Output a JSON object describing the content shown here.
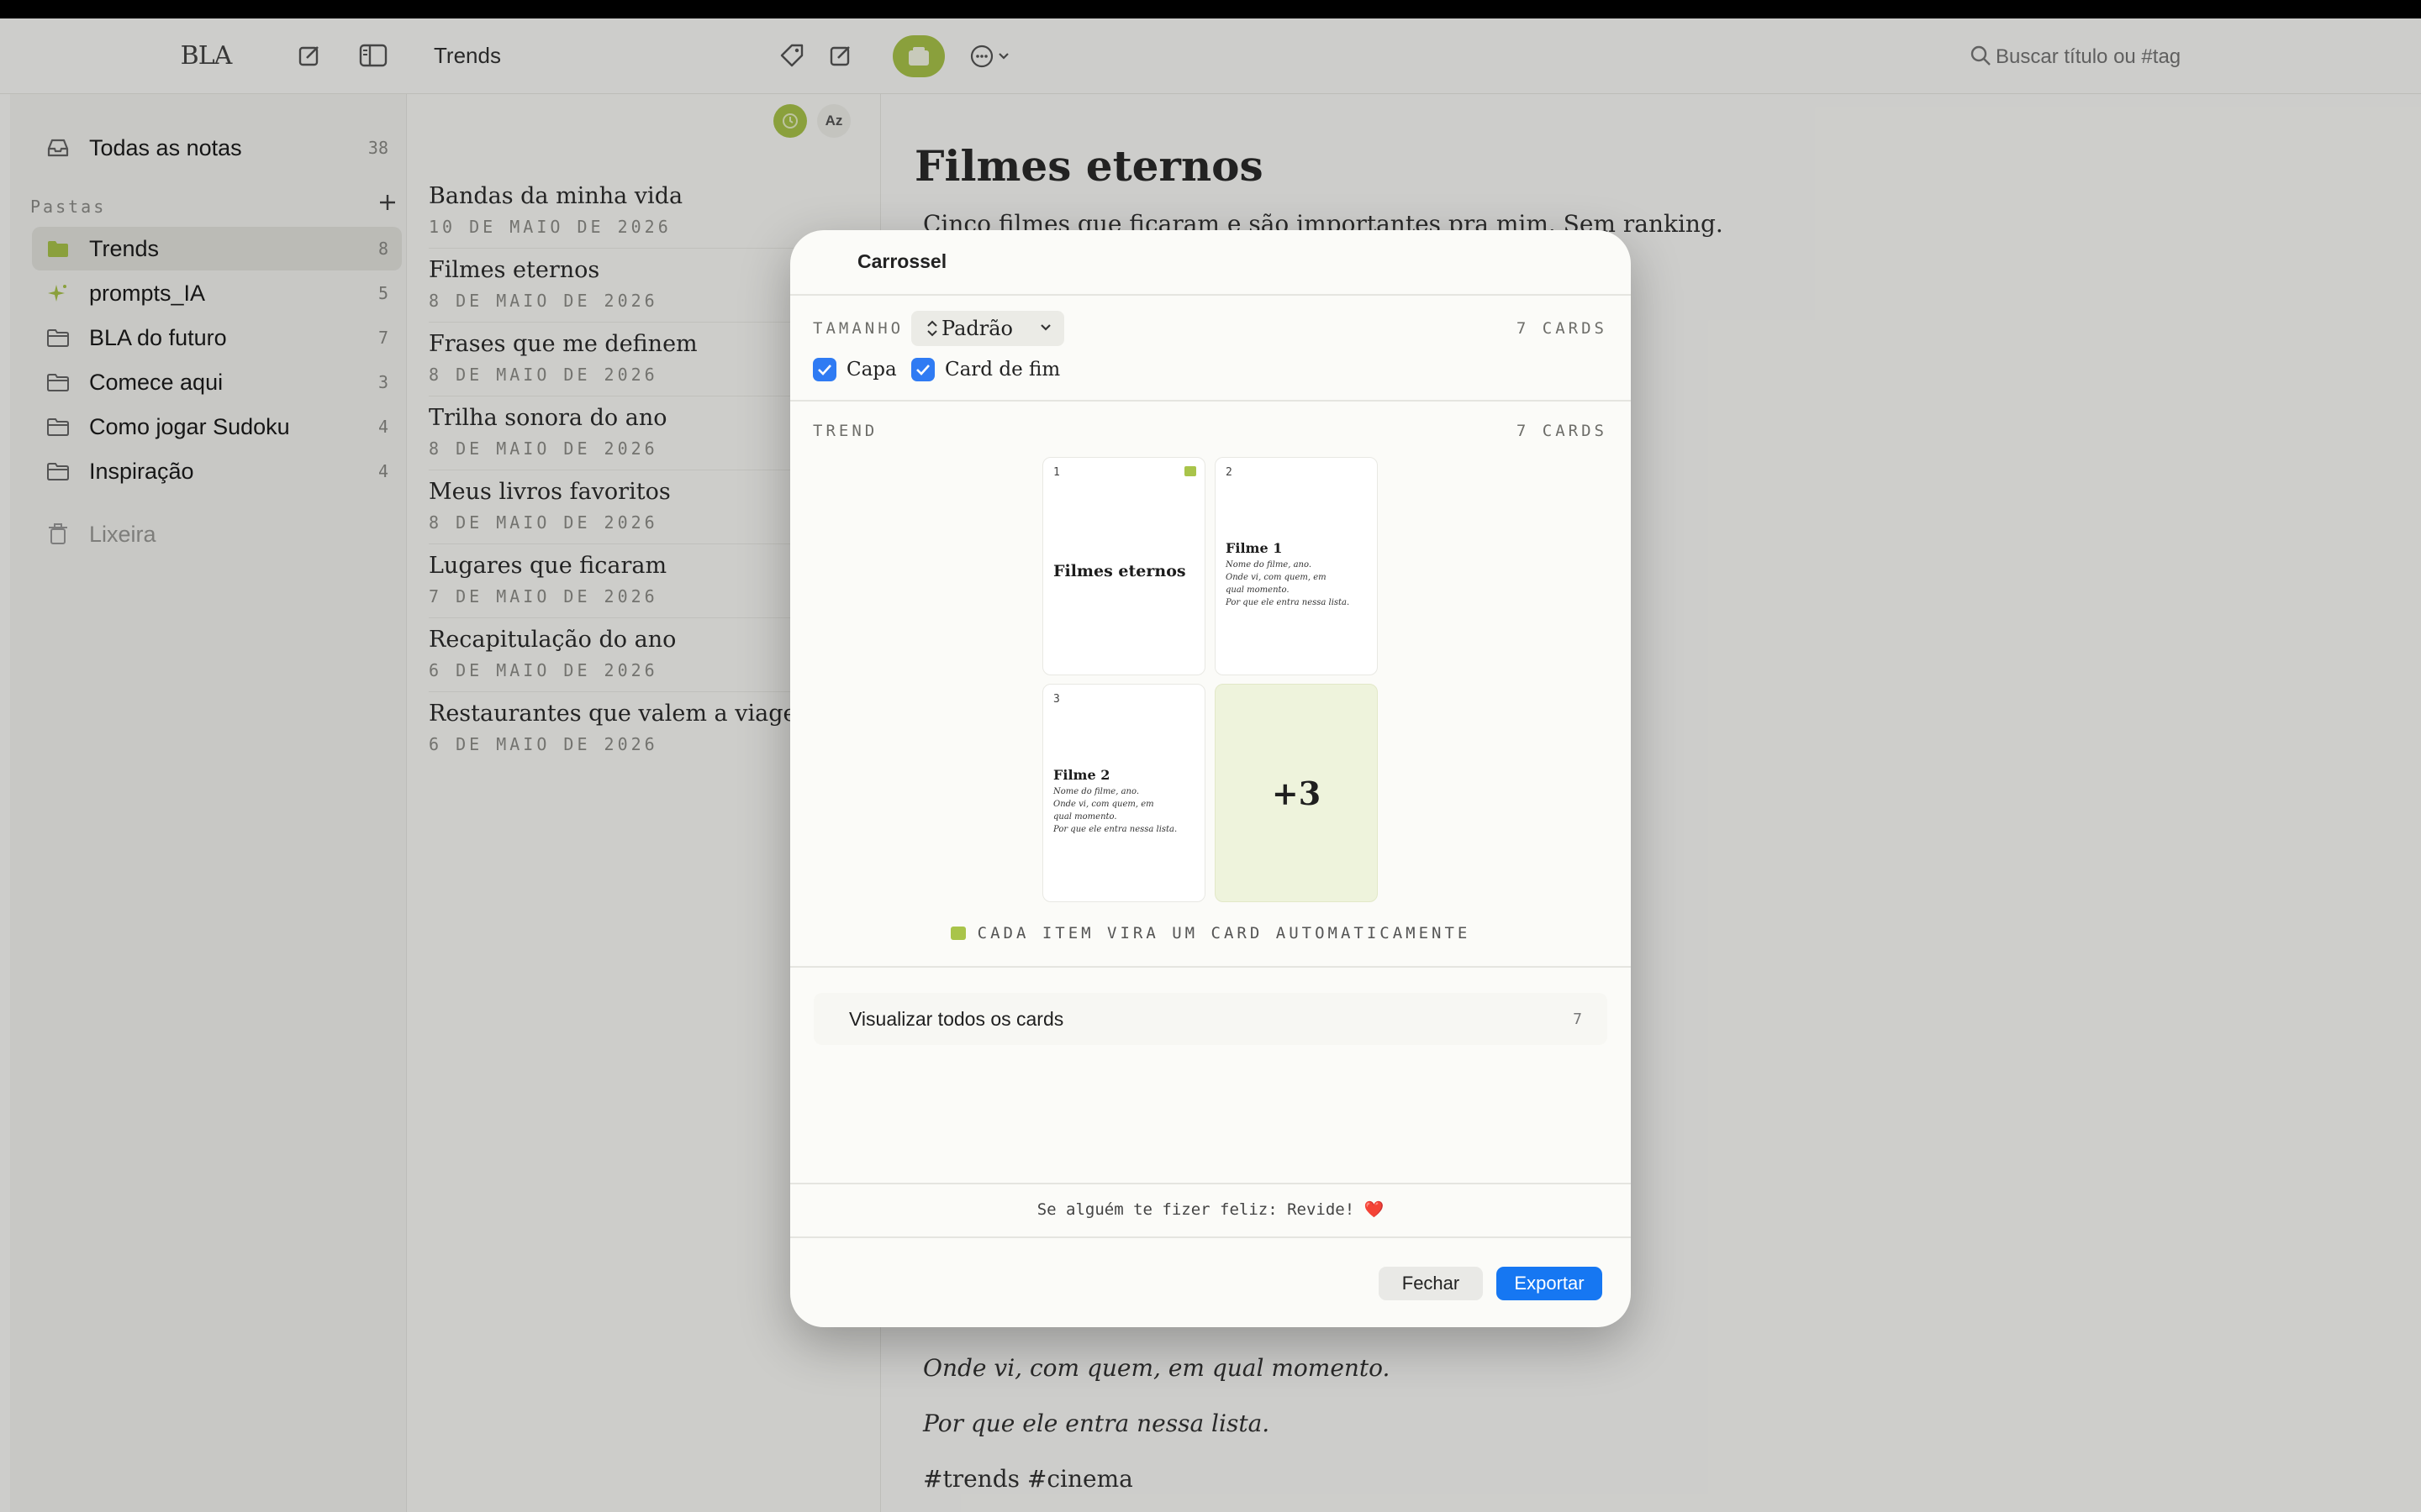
{
  "toolbar": {
    "logo": "BLA",
    "folder_title": "Trends",
    "search_placeholder": "Buscar título ou #tag"
  },
  "sidebar": {
    "all_notes": {
      "label": "Todas as notas",
      "count": "38"
    },
    "folders_heading": "Pastas",
    "folders": [
      {
        "label": "Trends",
        "count": "8",
        "icon": "folder-filled-icon"
      },
      {
        "label": "prompts_IA",
        "count": "5",
        "icon": "sparkle-icon"
      },
      {
        "label": "BLA do futuro",
        "count": "7",
        "icon": "folder-icon"
      },
      {
        "label": "Comece aqui",
        "count": "3",
        "icon": "folder-icon"
      },
      {
        "label": "Como jogar Sudoku",
        "count": "4",
        "icon": "folder-icon"
      },
      {
        "label": "Inspiração",
        "count": "4",
        "icon": "folder-icon"
      }
    ],
    "trash": "Lixeira"
  },
  "notelist": {
    "sort_label": "Az",
    "notes": [
      {
        "title": "Bandas da minha vida",
        "date": "10 DE MAIO DE 2026"
      },
      {
        "title": "Filmes eternos",
        "date": "8 DE MAIO DE 2026"
      },
      {
        "title": "Frases que me definem",
        "date": "8 DE MAIO DE 2026"
      },
      {
        "title": "Trilha sonora do ano",
        "date": "8 DE MAIO DE 2026"
      },
      {
        "title": "Meus livros favoritos",
        "date": "8 DE MAIO DE 2026"
      },
      {
        "title": "Lugares que ficaram",
        "date": "7 DE MAIO DE 2026"
      },
      {
        "title": "Recapitulação do ano",
        "date": "6 DE MAIO DE 2026"
      },
      {
        "title": "Restaurantes que valem a viagem",
        "date": "6 DE MAIO DE 2026"
      }
    ]
  },
  "editor": {
    "title": "Filmes eternos",
    "intro": "Cinco filmes que ficaram e são importantes pra mim. Sem ranking.",
    "line1": "Onde vi, com quem, em qual momento.",
    "line2": "Por que ele entra nessa lista.",
    "tags": "#trends #cinema"
  },
  "modal": {
    "title": "Carrossel",
    "size_label": "TAMANHO",
    "size_value": "Padrão",
    "cards_count_top": "7 CARDS",
    "opt_cover": "Capa",
    "opt_end": "Card de fim",
    "trend_label": "TREND",
    "trend_count": "7 CARDS",
    "cards": [
      {
        "num": "1",
        "title": "Filmes eternos"
      },
      {
        "num": "2",
        "title": "Filme 1",
        "body": [
          "Nome do filme, ano.",
          "Onde vi, com quem, em",
          "qual momento.",
          "Por que ele entra nessa lista."
        ]
      },
      {
        "num": "3",
        "title": "Filme 2",
        "body": [
          "Nome do filme, ano.",
          "Onde vi, com quem, em",
          "qual momento.",
          "Por que ele entra nessa lista."
        ]
      },
      {
        "more": "+3"
      }
    ],
    "auto_hint": "CADA ITEM VIRA UM CARD AUTOMATICAMENTE",
    "view_all": "Visualizar todos os cards",
    "view_all_count": "7",
    "footer_quote": "Se alguém te fizer feliz: Revide! ❤️",
    "btn_close": "Fechar",
    "btn_export": "Exportar"
  },
  "colors": {
    "accent_green": "#a9c44a",
    "accent_blue": "#1677f2",
    "card_more_bg": "#eef3dc"
  }
}
